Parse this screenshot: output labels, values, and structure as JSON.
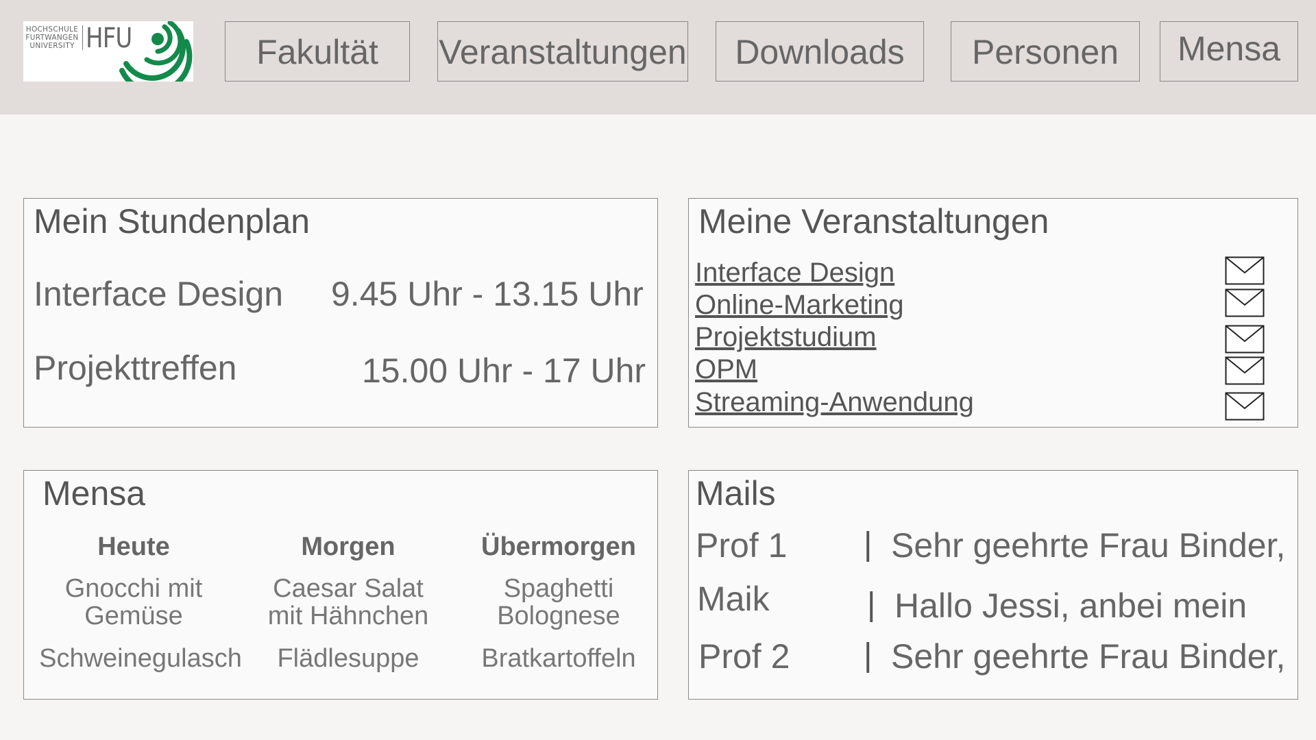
{
  "header": {
    "logo": {
      "line1": "HOCHSCHULE",
      "line2": "FURTWANGEN",
      "line3": "UNIVERSITY",
      "abbr": "HFU",
      "accent": "#138a4b"
    },
    "nav": [
      "Fakultät",
      "Veranstaltungen",
      "Downloads",
      "Personen",
      "Mensa"
    ]
  },
  "schedule": {
    "title": "Mein Stundenplan",
    "items": [
      {
        "name": "Interface Design",
        "time": "9.45 Uhr - 13.15 Uhr"
      },
      {
        "name": "Projekttreffen",
        "time": "15.00 Uhr - 17 Uhr"
      }
    ]
  },
  "courses": {
    "title": "Meine Veranstaltungen",
    "items": [
      "Interface Design",
      "Online-Marketing",
      "Projektstudium",
      "OPM",
      "Streaming-Anwendung"
    ],
    "icon": "mail-icon"
  },
  "mensa": {
    "title": "Mensa",
    "days": [
      "Heute",
      "Morgen",
      "Übermorgen"
    ],
    "meals_row1": [
      {
        "l1": "Gnocchi mit",
        "l2": "Gemüse"
      },
      {
        "l1": "Caesar Salat",
        "l2": "mit Hähnchen"
      },
      {
        "l1": "Spaghetti",
        "l2": "Bolognese"
      }
    ],
    "meals_row2": [
      "Schweinegulasch",
      "Flädlesuppe",
      "Bratkartoffeln"
    ]
  },
  "mails": {
    "title": "Mails",
    "separator": "|",
    "items": [
      {
        "sender": "Prof 1",
        "preview": "Sehr geehrte Frau Binder,"
      },
      {
        "sender": "Maik",
        "preview": "Hallo Jessi, anbei mein"
      },
      {
        "sender": "Prof 2",
        "preview": "Sehr geehrte Frau Binder,"
      }
    ]
  }
}
